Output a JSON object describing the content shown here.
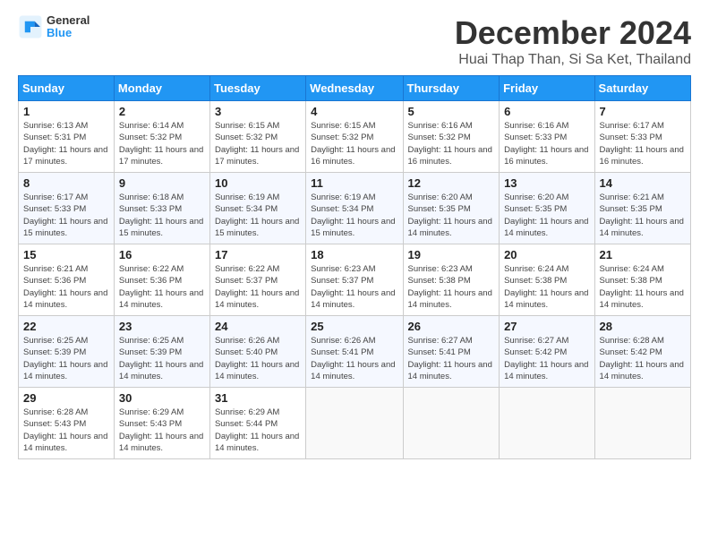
{
  "header": {
    "logo_line1": "General",
    "logo_line2": "Blue",
    "month": "December 2024",
    "location": "Huai Thap Than, Si Sa Ket, Thailand"
  },
  "calendar": {
    "headers": [
      "Sunday",
      "Monday",
      "Tuesday",
      "Wednesday",
      "Thursday",
      "Friday",
      "Saturday"
    ],
    "weeks": [
      [
        {
          "day": "1",
          "sunrise": "6:13 AM",
          "sunset": "5:31 PM",
          "daylight": "11 hours and 17 minutes."
        },
        {
          "day": "2",
          "sunrise": "6:14 AM",
          "sunset": "5:32 PM",
          "daylight": "11 hours and 17 minutes."
        },
        {
          "day": "3",
          "sunrise": "6:15 AM",
          "sunset": "5:32 PM",
          "daylight": "11 hours and 17 minutes."
        },
        {
          "day": "4",
          "sunrise": "6:15 AM",
          "sunset": "5:32 PM",
          "daylight": "11 hours and 16 minutes."
        },
        {
          "day": "5",
          "sunrise": "6:16 AM",
          "sunset": "5:32 PM",
          "daylight": "11 hours and 16 minutes."
        },
        {
          "day": "6",
          "sunrise": "6:16 AM",
          "sunset": "5:33 PM",
          "daylight": "11 hours and 16 minutes."
        },
        {
          "day": "7",
          "sunrise": "6:17 AM",
          "sunset": "5:33 PM",
          "daylight": "11 hours and 16 minutes."
        }
      ],
      [
        {
          "day": "8",
          "sunrise": "6:17 AM",
          "sunset": "5:33 PM",
          "daylight": "11 hours and 15 minutes."
        },
        {
          "day": "9",
          "sunrise": "6:18 AM",
          "sunset": "5:33 PM",
          "daylight": "11 hours and 15 minutes."
        },
        {
          "day": "10",
          "sunrise": "6:19 AM",
          "sunset": "5:34 PM",
          "daylight": "11 hours and 15 minutes."
        },
        {
          "day": "11",
          "sunrise": "6:19 AM",
          "sunset": "5:34 PM",
          "daylight": "11 hours and 15 minutes."
        },
        {
          "day": "12",
          "sunrise": "6:20 AM",
          "sunset": "5:35 PM",
          "daylight": "11 hours and 14 minutes."
        },
        {
          "day": "13",
          "sunrise": "6:20 AM",
          "sunset": "5:35 PM",
          "daylight": "11 hours and 14 minutes."
        },
        {
          "day": "14",
          "sunrise": "6:21 AM",
          "sunset": "5:35 PM",
          "daylight": "11 hours and 14 minutes."
        }
      ],
      [
        {
          "day": "15",
          "sunrise": "6:21 AM",
          "sunset": "5:36 PM",
          "daylight": "11 hours and 14 minutes."
        },
        {
          "day": "16",
          "sunrise": "6:22 AM",
          "sunset": "5:36 PM",
          "daylight": "11 hours and 14 minutes."
        },
        {
          "day": "17",
          "sunrise": "6:22 AM",
          "sunset": "5:37 PM",
          "daylight": "11 hours and 14 minutes."
        },
        {
          "day": "18",
          "sunrise": "6:23 AM",
          "sunset": "5:37 PM",
          "daylight": "11 hours and 14 minutes."
        },
        {
          "day": "19",
          "sunrise": "6:23 AM",
          "sunset": "5:38 PM",
          "daylight": "11 hours and 14 minutes."
        },
        {
          "day": "20",
          "sunrise": "6:24 AM",
          "sunset": "5:38 PM",
          "daylight": "11 hours and 14 minutes."
        },
        {
          "day": "21",
          "sunrise": "6:24 AM",
          "sunset": "5:38 PM",
          "daylight": "11 hours and 14 minutes."
        }
      ],
      [
        {
          "day": "22",
          "sunrise": "6:25 AM",
          "sunset": "5:39 PM",
          "daylight": "11 hours and 14 minutes."
        },
        {
          "day": "23",
          "sunrise": "6:25 AM",
          "sunset": "5:39 PM",
          "daylight": "11 hours and 14 minutes."
        },
        {
          "day": "24",
          "sunrise": "6:26 AM",
          "sunset": "5:40 PM",
          "daylight": "11 hours and 14 minutes."
        },
        {
          "day": "25",
          "sunrise": "6:26 AM",
          "sunset": "5:41 PM",
          "daylight": "11 hours and 14 minutes."
        },
        {
          "day": "26",
          "sunrise": "6:27 AM",
          "sunset": "5:41 PM",
          "daylight": "11 hours and 14 minutes."
        },
        {
          "day": "27",
          "sunrise": "6:27 AM",
          "sunset": "5:42 PM",
          "daylight": "11 hours and 14 minutes."
        },
        {
          "day": "28",
          "sunrise": "6:28 AM",
          "sunset": "5:42 PM",
          "daylight": "11 hours and 14 minutes."
        }
      ],
      [
        {
          "day": "29",
          "sunrise": "6:28 AM",
          "sunset": "5:43 PM",
          "daylight": "11 hours and 14 minutes."
        },
        {
          "day": "30",
          "sunrise": "6:29 AM",
          "sunset": "5:43 PM",
          "daylight": "11 hours and 14 minutes."
        },
        {
          "day": "31",
          "sunrise": "6:29 AM",
          "sunset": "5:44 PM",
          "daylight": "11 hours and 14 minutes."
        },
        null,
        null,
        null,
        null
      ]
    ]
  }
}
